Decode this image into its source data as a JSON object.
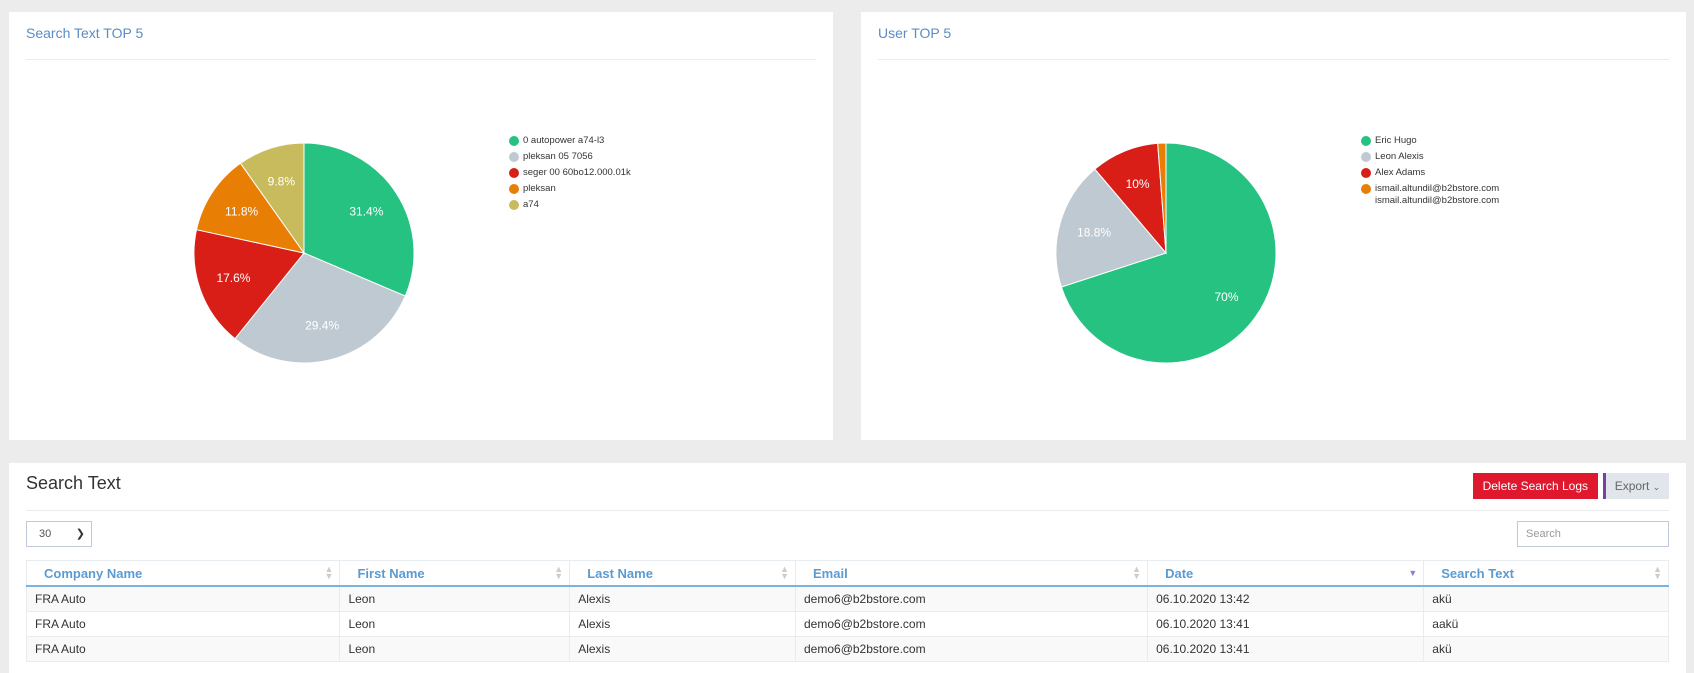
{
  "left_panel": {
    "title": "Search Text TOP 5"
  },
  "right_panel": {
    "title": "User TOP 5"
  },
  "chart_data": [
    {
      "type": "pie",
      "title": "Search Text TOP 5",
      "legend_position": "right",
      "labels": [
        "0 autopower a74-l3",
        "pleksan 05 7056",
        "seger 00 60bo12.000.01k",
        "pleksan",
        "a74"
      ],
      "values": [
        31.4,
        29.4,
        17.6,
        11.8,
        9.8
      ],
      "data_labels": [
        "31.4%",
        "29.4%",
        "17.6%",
        "11.8%",
        "9.8%"
      ],
      "colors": [
        "#26c281",
        "#bfc9d1",
        "#d91e18",
        "#e87e04",
        "#c8bb5e"
      ]
    },
    {
      "type": "pie",
      "title": "User TOP 5",
      "legend_position": "right",
      "labels": [
        "Eric Hugo",
        "Leon Alexis",
        "Alex Adams",
        "ismail.altundil@b2bstore.com\nismail.altundil@b2bstore.com"
      ],
      "values": [
        70,
        18.8,
        10,
        1.2
      ],
      "data_labels": [
        "70%",
        "18.8%",
        "10%",
        ""
      ],
      "colors": [
        "#26c281",
        "#bfc9d1",
        "#d91e18",
        "#e87e04"
      ]
    }
  ],
  "table_section": {
    "title": "Search Text",
    "delete_button": "Delete Search Logs",
    "export_button": "Export",
    "page_size": "30",
    "search_placeholder": "Search",
    "columns": [
      "Company Name",
      "First Name",
      "Last Name",
      "Email",
      "Date",
      "Search Text"
    ],
    "sorted_column": "Date",
    "rows": [
      [
        "FRA Auto",
        "Leon",
        "Alexis",
        "demo6@b2bstore.com",
        "06.10.2020 13:42",
        "akü"
      ],
      [
        "FRA Auto",
        "Leon",
        "Alexis",
        "demo6@b2bstore.com",
        "06.10.2020 13:41",
        "aakü"
      ],
      [
        "FRA Auto",
        "Leon",
        "Alexis",
        "demo6@b2bstore.com",
        "06.10.2020 13:41",
        "akü"
      ]
    ]
  }
}
